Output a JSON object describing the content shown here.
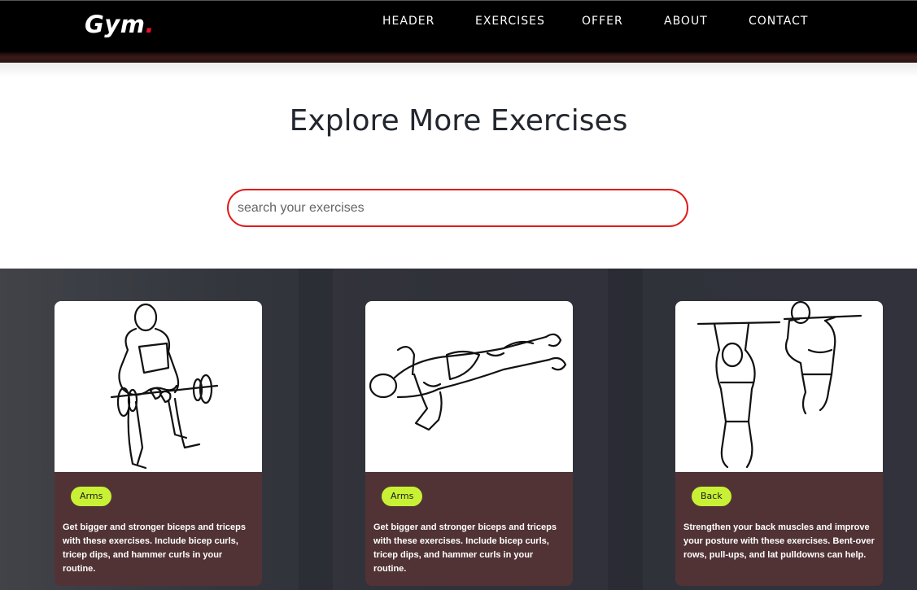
{
  "brand": {
    "name": "Gym",
    "dot": "."
  },
  "nav": {
    "items": [
      {
        "label": "HEADER"
      },
      {
        "label": "EXERCISES"
      },
      {
        "label": "OFFER"
      },
      {
        "label": "ABOUT"
      },
      {
        "label": "CONTACT"
      }
    ]
  },
  "main": {
    "title": "Explore More Exercises",
    "search": {
      "placeholder": "search your exercises",
      "value": ""
    }
  },
  "cards": [
    {
      "tag": "Arms",
      "description": "Get bigger and stronger biceps and triceps with these exercises. Include bicep curls, tricep dips, and hammer curls in your routine.",
      "image": "barbell-curl-illustration"
    },
    {
      "tag": "Arms",
      "description": "Get bigger and stronger biceps and triceps with these exercises. Include bicep curls, tricep dips, and hammer curls in your routine.",
      "image": "push-up-illustration"
    },
    {
      "tag": "Back",
      "description": "Strengthen your back muscles and improve your posture with these exercises. Bent-over rows, pull-ups, and lat pulldowns can help.",
      "image": "pull-up-illustration"
    }
  ],
  "colors": {
    "accent_red": "#e01b1b",
    "tag_lime": "#c8f135",
    "card_bg": "#523335",
    "nav_bg": "#000000"
  }
}
